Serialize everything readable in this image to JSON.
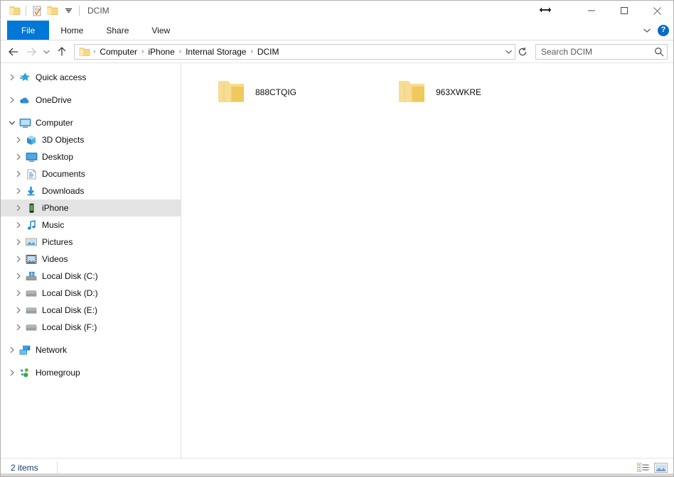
{
  "window": {
    "title": "DCIM",
    "quick_access": [
      {
        "name": "folder-icon",
        "label": "Folder"
      },
      {
        "name": "properties-icon",
        "label": "Properties"
      },
      {
        "name": "new-folder-icon",
        "label": "New folder"
      },
      {
        "name": "customize-quick-access-icon",
        "label": "Customize Quick Access Toolbar"
      }
    ],
    "caption": {
      "minimize": "Minimize",
      "maximize": "Maximize",
      "close": "Close"
    }
  },
  "ribbon": {
    "tabs": [
      {
        "label": "File",
        "active": true
      },
      {
        "label": "Home",
        "active": false
      },
      {
        "label": "Share",
        "active": false
      },
      {
        "label": "View",
        "active": false
      }
    ],
    "collapse_label": "Minimize the Ribbon",
    "help_label": "?"
  },
  "navigation": {
    "back_label": "Back",
    "forward_label": "Forward",
    "recent_label": "Recent locations",
    "up_label": "Up",
    "breadcrumbs": [
      "Computer",
      "iPhone",
      "Internal Storage",
      "DCIM"
    ],
    "separator": "›",
    "dropdown_label": "Previous locations",
    "refresh_label": "Refresh"
  },
  "search": {
    "placeholder": "Search DCIM",
    "value": ""
  },
  "sidebar": {
    "items": [
      {
        "label": "Quick access",
        "icon": "star-icon",
        "level": 0,
        "expanded": false,
        "selected": false,
        "gap": false
      },
      {
        "label": "OneDrive",
        "icon": "cloud-icon",
        "level": 0,
        "expanded": false,
        "selected": false,
        "gap": true
      },
      {
        "label": "Computer",
        "icon": "monitor-icon",
        "level": 0,
        "expanded": true,
        "selected": false,
        "gap": true
      },
      {
        "label": "3D Objects",
        "icon": "cube-icon",
        "level": 1,
        "expanded": false,
        "selected": false,
        "gap": false
      },
      {
        "label": "Desktop",
        "icon": "desktop-icon",
        "level": 1,
        "expanded": false,
        "selected": false,
        "gap": false
      },
      {
        "label": "Documents",
        "icon": "document-icon",
        "level": 1,
        "expanded": false,
        "selected": false,
        "gap": false
      },
      {
        "label": "Downloads",
        "icon": "download-icon",
        "level": 1,
        "expanded": false,
        "selected": false,
        "gap": false
      },
      {
        "label": "iPhone",
        "icon": "phone-icon",
        "level": 1,
        "expanded": false,
        "selected": true,
        "gap": false
      },
      {
        "label": "Music",
        "icon": "music-icon",
        "level": 1,
        "expanded": false,
        "selected": false,
        "gap": false
      },
      {
        "label": "Pictures",
        "icon": "picture-icon",
        "level": 1,
        "expanded": false,
        "selected": false,
        "gap": false
      },
      {
        "label": "Videos",
        "icon": "video-icon",
        "level": 1,
        "expanded": false,
        "selected": false,
        "gap": false
      },
      {
        "label": "Local Disk (C:)",
        "icon": "system-drive-icon",
        "level": 1,
        "expanded": false,
        "selected": false,
        "gap": false
      },
      {
        "label": "Local Disk (D:)",
        "icon": "drive-icon",
        "level": 1,
        "expanded": false,
        "selected": false,
        "gap": false
      },
      {
        "label": "Local Disk (E:)",
        "icon": "drive-icon",
        "level": 1,
        "expanded": false,
        "selected": false,
        "gap": false
      },
      {
        "label": "Local Disk (F:)",
        "icon": "drive-icon",
        "level": 1,
        "expanded": false,
        "selected": false,
        "gap": false
      },
      {
        "label": "Network",
        "icon": "network-icon",
        "level": 0,
        "expanded": false,
        "selected": false,
        "gap": true
      },
      {
        "label": "Homegroup",
        "icon": "homegroup-icon",
        "level": 0,
        "expanded": false,
        "selected": false,
        "gap": true
      }
    ]
  },
  "content": {
    "items": [
      {
        "label": "888CTQIG",
        "icon": "folder-icon"
      },
      {
        "label": "963XWKRE",
        "icon": "folder-icon"
      }
    ]
  },
  "status": {
    "item_count": "2 items",
    "views": [
      {
        "name": "details-view-button",
        "label": "Details view"
      },
      {
        "name": "large-icons-view-button",
        "label": "Large icons view"
      }
    ]
  },
  "colors": {
    "accent": "#0078d7",
    "folder": "#f5d67f",
    "selection": "#e4e4e4",
    "status_text": "#1b3a6b"
  }
}
